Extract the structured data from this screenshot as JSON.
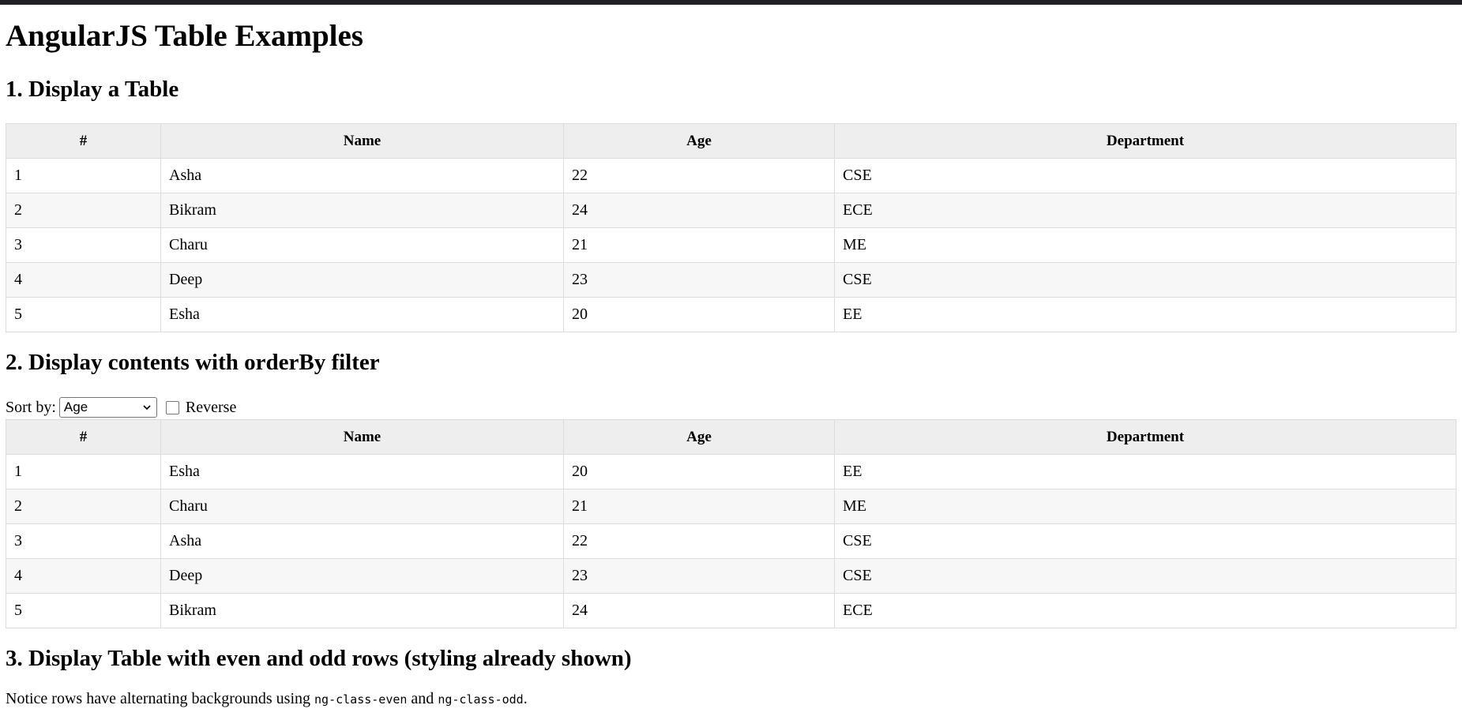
{
  "page": {
    "title": "AngularJS Table Examples"
  },
  "section1": {
    "heading": "1. Display a Table",
    "columns": [
      "#",
      "Name",
      "Age",
      "Department"
    ],
    "rows": [
      [
        "1",
        "Asha",
        "22",
        "CSE"
      ],
      [
        "2",
        "Bikram",
        "24",
        "ECE"
      ],
      [
        "3",
        "Charu",
        "21",
        "ME"
      ],
      [
        "4",
        "Deep",
        "23",
        "CSE"
      ],
      [
        "5",
        "Esha",
        "20",
        "EE"
      ]
    ]
  },
  "section2": {
    "heading": "2. Display contents with orderBy filter",
    "sort_label": "Sort by:",
    "sort_value": "Age",
    "reverse_label": "Reverse",
    "reverse_checked": false,
    "columns": [
      "#",
      "Name",
      "Age",
      "Department"
    ],
    "rows": [
      [
        "1",
        "Esha",
        "20",
        "EE"
      ],
      [
        "2",
        "Charu",
        "21",
        "ME"
      ],
      [
        "3",
        "Asha",
        "22",
        "CSE"
      ],
      [
        "4",
        "Deep",
        "23",
        "CSE"
      ],
      [
        "5",
        "Bikram",
        "24",
        "ECE"
      ]
    ]
  },
  "section3": {
    "heading": "3. Display Table with even and odd rows (styling already shown)",
    "note_prefix": "Notice rows have alternating backgrounds using ",
    "code1": "ng-class-even",
    "note_mid": " and ",
    "code2": "ng-class-odd",
    "note_suffix": "."
  },
  "colors": {
    "header_bg": "#eeeeee",
    "row_even_bg": "#f7f7f7",
    "row_odd_bg": "#ffffff",
    "border": "#dcdcdc",
    "top_bar": "#202124"
  },
  "icons": {
    "select_arrow": "chevron-down-icon"
  }
}
